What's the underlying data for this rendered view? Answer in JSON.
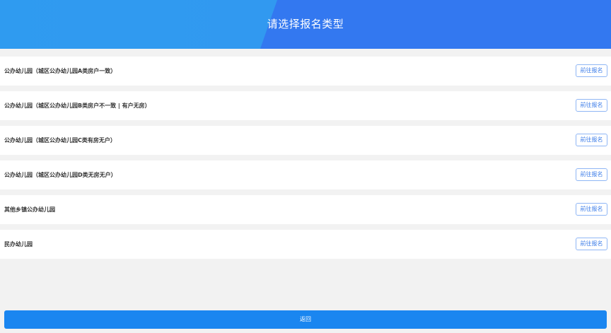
{
  "header": {
    "title": "请选择报名类型"
  },
  "items": [
    {
      "label": "公办幼儿园（城区公办幼儿园A类房户一致）",
      "button": "前往报名"
    },
    {
      "label": "公办幼儿园（城区公办幼儿园B类房户不一致 | 有户无房）",
      "button": "前往报名"
    },
    {
      "label": "公办幼儿园（城区公办幼儿园C类有房无户）",
      "button": "前往报名"
    },
    {
      "label": "公办幼儿园（城区公办幼儿园D类无房无户）",
      "button": "前往报名"
    },
    {
      "label": "其他乡镇公办幼儿园",
      "button": "前往报名"
    },
    {
      "label": "民办幼儿园",
      "button": "前往报名"
    }
  ],
  "footer": {
    "back_label": "返回"
  },
  "colors": {
    "header": "#3378f0",
    "header_left": "#2f9bf0",
    "accent": "#1a86f0",
    "background": "#f2f2f2"
  }
}
